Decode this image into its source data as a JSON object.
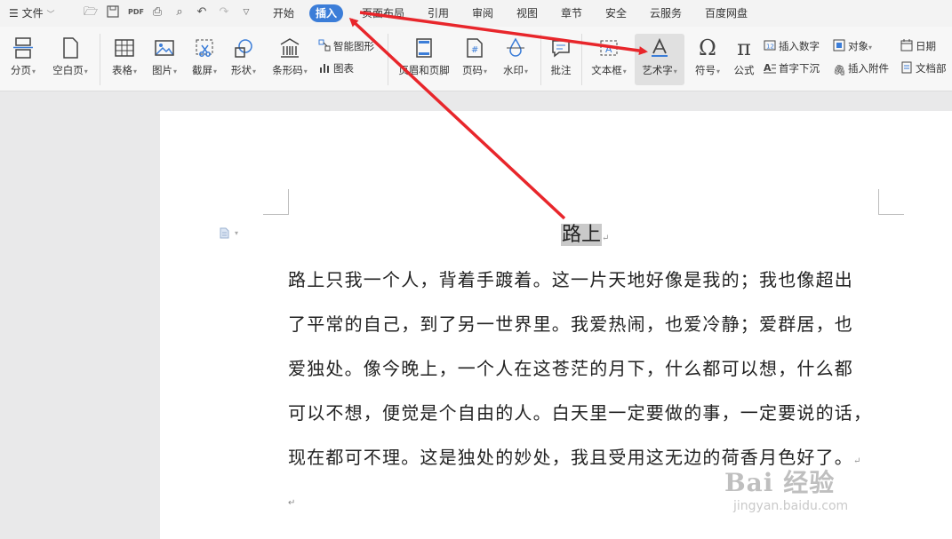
{
  "menubar": {
    "file_label": "文件",
    "tabs": [
      "开始",
      "插入",
      "页面布局",
      "引用",
      "审阅",
      "视图",
      "章节",
      "安全",
      "云服务",
      "百度网盘"
    ]
  },
  "ribbon": {
    "items": {
      "page_break": "分页",
      "blank_page": "空白页",
      "table": "表格",
      "picture": "图片",
      "screenshot": "截屏",
      "shape": "形状",
      "barcode": "条形码",
      "smart_art": "智能图形",
      "chart": "图表",
      "header_footer": "页眉和页脚",
      "page_number": "页码",
      "watermark": "水印",
      "comment": "批注",
      "text_box": "文本框",
      "word_art": "艺术字",
      "symbol": "符号",
      "formula": "公式",
      "insert_number": "插入数字",
      "object": "对象",
      "date": "日期",
      "drop_cap": "首字下沉",
      "attachment": "插入附件",
      "doc_part": "文档部"
    }
  },
  "document": {
    "title": "路上",
    "paragraph_lines": [
      "路上只我一个人，背着手踱着。这一片天地好像是我的；我也像超出",
      "了平常的自己，到了另一世界里。我爱热闹，也爱冷静；爱群居，也",
      "爱独处。像今晚上，一个人在这苍茫的月下，什么都可以想，什么都",
      "可以不想，便觉是个自由的人。白天里一定要做的事，一定要说的话，",
      "现在都可不理。这是独处的妙处，我且受用这无边的荷香月色好了。"
    ],
    "paragraph_mark": "↵"
  },
  "watermark": {
    "brand": "Bai 经验",
    "url": "jingyan.baidu.com"
  },
  "colors": {
    "accent": "#3b7dd8",
    "arrow": "#e8262b"
  }
}
